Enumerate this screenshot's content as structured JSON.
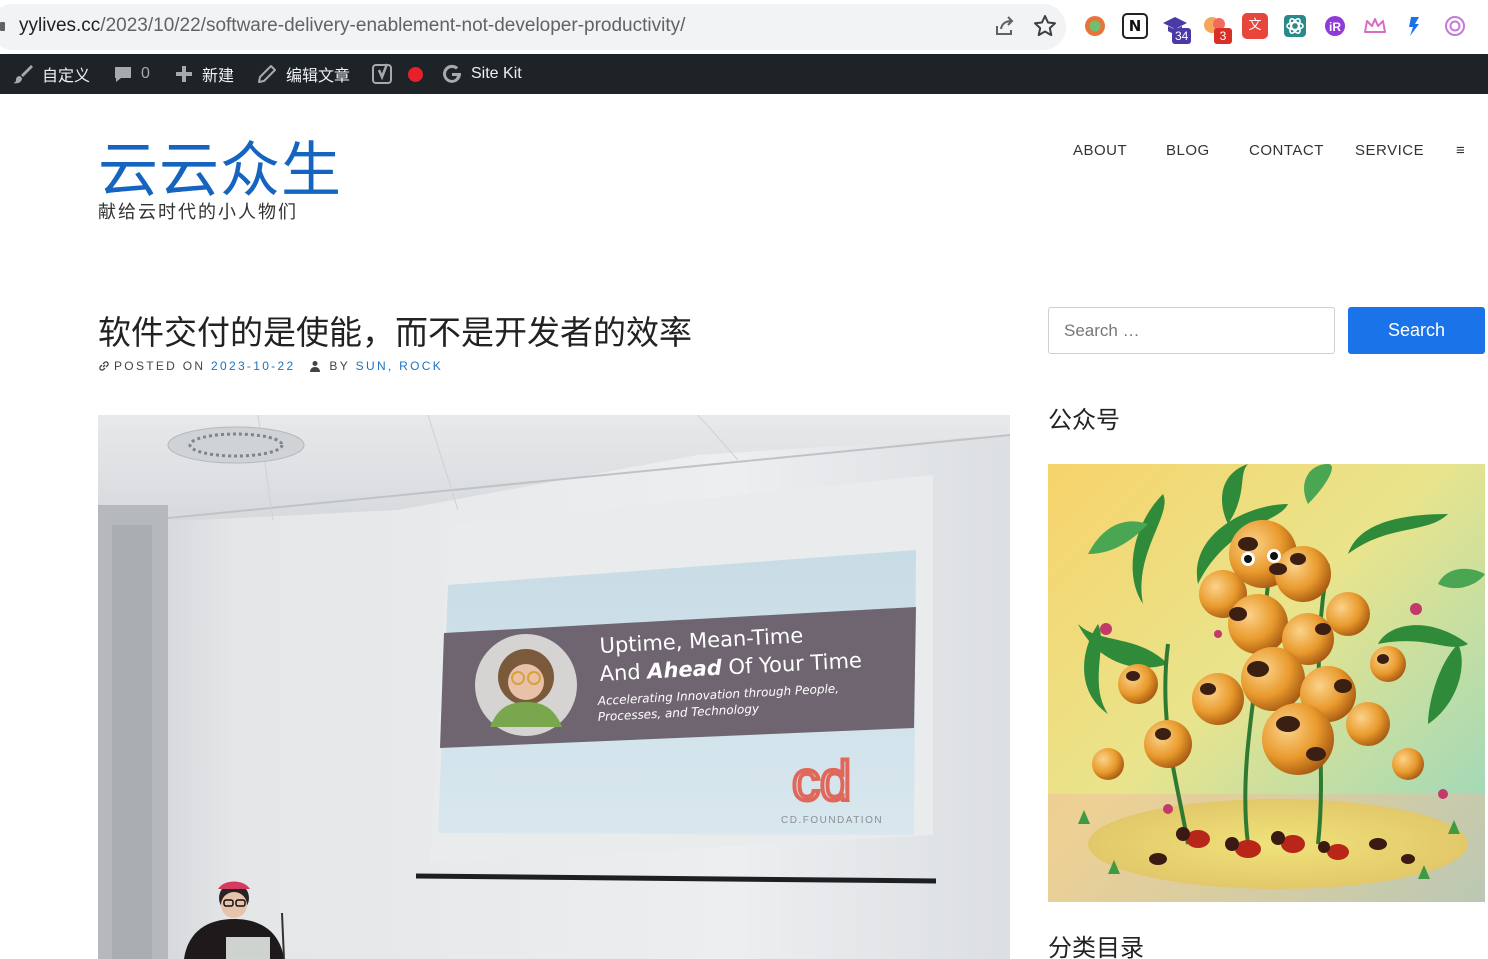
{
  "browser": {
    "url_host": "yylives.cc",
    "url_path": "/2023/10/22/software-delivery-enablement-not-developer-productivity/",
    "actions": [
      "share-icon",
      "bookmark-star-icon"
    ],
    "extensions": [
      {
        "icon": "circle-extension-icon",
        "badge": ""
      },
      {
        "icon": "notion-icon",
        "badge": ""
      },
      {
        "icon": "graduation-cap-icon",
        "badge": "34"
      },
      {
        "icon": "chat-bubbles-icon",
        "badge": "3"
      },
      {
        "icon": "translate-icon",
        "badge": ""
      },
      {
        "icon": "atom-icon",
        "badge": ""
      },
      {
        "icon": "r-logo-icon",
        "badge": ""
      },
      {
        "icon": "crown-icon",
        "badge": ""
      },
      {
        "icon": "flag-icon",
        "badge": ""
      },
      {
        "icon": "openai-icon",
        "badge": ""
      }
    ]
  },
  "adminbar": {
    "customize": "自定义",
    "comments_count": "0",
    "new": "新建",
    "edit": "编辑文章",
    "sitekit": "Site Kit"
  },
  "site": {
    "title": "云云众生",
    "tagline": "献给云时代的小人物们"
  },
  "nav": {
    "about": "ABOUT",
    "blog": "BLOG",
    "contact": "CONTACT",
    "service": "SERVICE",
    "menu": "≡"
  },
  "post": {
    "title": "软件交付的是使能，而不是开发者的效率",
    "posted_on": "POSTED ON",
    "date": "2023-10-22",
    "by": "BY",
    "author": "SUN, ROCK"
  },
  "slide": {
    "headline_1": "Uptime, Mean-Time",
    "headline_2a": "And ",
    "headline_2b": "Ahead",
    "headline_2c": " Of Your Time",
    "sub_1": "Accelerating Innovation through People,",
    "sub_2": "Processes, and Technology",
    "logo": "cd",
    "brand": "CD.FOUNDATION"
  },
  "sidebar": {
    "search_placeholder": "Search …",
    "search_button": "Search",
    "widget_1_title": "公众号",
    "widget_2_title": "分类目录"
  },
  "colors": {
    "accent": "#1a73e8",
    "site_title": "#1565c0",
    "adminbar_bg": "#1d2327",
    "link": "#1e73be"
  }
}
